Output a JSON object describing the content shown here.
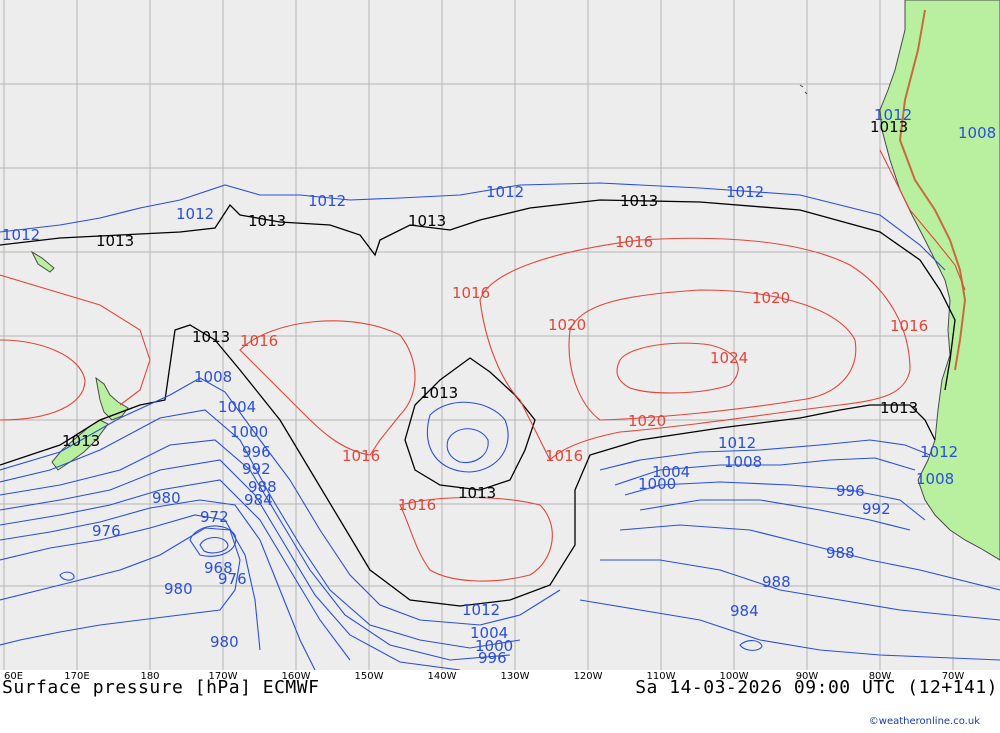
{
  "map": {
    "title": "Surface pressure [hPa] ECMWF",
    "valid_time": "Sa 14-03-2026 09:00 UTC (12+141)",
    "credit": "©weatheronline.co.uk",
    "colors": {
      "ocean": "#ededed",
      "land": "#b8f0a0",
      "grid": "#b5b5b5",
      "isobar_low": "#2a4fd8",
      "isobar_ref": "#000000",
      "isobar_high": "#e0473a",
      "coast": "#4a4a4a"
    },
    "longitude_labels": [
      "60E",
      "170E",
      "180",
      "170W",
      "160W",
      "150W",
      "140W",
      "130W",
      "120W",
      "110W",
      "100W",
      "90W",
      "80W",
      "70W"
    ],
    "isobar_labels": {
      "l1012a": "1012",
      "l1012b": "1012",
      "l1012c": "1012",
      "l1012d": "1012",
      "l1012e": "1012",
      "l1013a": "1013",
      "l1013b": "1013",
      "l1013c": "1013",
      "l1013d": "1013",
      "l1013e": "1013",
      "l1013f": "1013",
      "l1013g": "1013",
      "l1013h": "1013",
      "l1013i": "1013",
      "l1013j": "1013",
      "l1016a": "1016",
      "l1016b": "1016",
      "l1016c": "1016",
      "l1016d": "1016",
      "l1016e": "1016",
      "l1016f": "1016",
      "l1016g": "1016",
      "l1020a": "1020",
      "l1020b": "1020",
      "l1020c": "1020",
      "l1024": "1024",
      "l1008a": "1008",
      "l1008b": "1008",
      "l1004a": "1004",
      "l1004b": "1004",
      "l1004c": "1004",
      "l1000a": "1000",
      "l1000b": "1000",
      "l1000c": "1000",
      "l996a": "996",
      "l996b": "996",
      "l996c": "996",
      "l992a": "992",
      "l992b": "992",
      "l988a": "988",
      "l988b": "988",
      "l988c": "988",
      "l984a": "984",
      "l984b": "984",
      "l980a": "980",
      "l980b": "980",
      "l980c": "980",
      "l976a": "976",
      "l976b": "976",
      "l972": "972",
      "l968": "968",
      "l1012f": "1012",
      "l1012g": "1012",
      "l1012h": "1012",
      "l1012i": "1012",
      "l1008c": "1008",
      "l1008d": "1008"
    }
  }
}
